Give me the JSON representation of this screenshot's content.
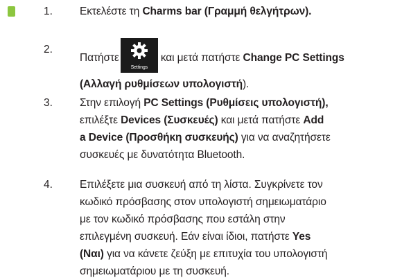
{
  "steps": [
    {
      "number": "1.",
      "lines": [
        [
          {
            "t": "Εκτελέστε τη ",
            "b": false
          },
          {
            "t": "Charms bar (Γραμμή θελγήτρων).",
            "b": true
          }
        ]
      ]
    },
    {
      "number": "2.",
      "lines": [
        [
          {
            "t": "Πατήστε",
            "b": false
          },
          {
            "tile": true
          },
          {
            "t": "και μετά πατήστε ",
            "b": false
          },
          {
            "t": "Change PC Settings",
            "b": true
          }
        ],
        [
          {
            "t": "(Αλλαγή ρυθμίσεων υπολογιστή",
            "b": true
          },
          {
            "t": ").",
            "b": false
          }
        ]
      ]
    },
    {
      "number": "3.",
      "lines": [
        [
          {
            "t": "Στην επιλογή ",
            "b": false
          },
          {
            "t": "PC Settings (Ρυθμίσεις υπολογιστή),",
            "b": true
          }
        ],
        [
          {
            "t": "επιλέξτε ",
            "b": false
          },
          {
            "t": "Devices (Συσκευές)",
            "b": true
          },
          {
            "t": " και μετά πατήστε ",
            "b": false
          },
          {
            "t": "Add",
            "b": true
          }
        ],
        [
          {
            "t": "a Device (Προσθήκη συσκευής)",
            "b": true
          },
          {
            "t": " για να αναζητήσετε",
            "b": false
          }
        ],
        [
          {
            "t": "συσκευές με δυνατότητα Bluetooth.",
            "b": false
          }
        ]
      ]
    },
    {
      "number": "4.",
      "lines": [
        [
          {
            "t": "Επιλέξετε μια συσκευή από τη λίστα. Συγκρίνετε τον",
            "b": false
          }
        ],
        [
          {
            "t": "κωδικό πρόσβασης στον υπολογιστή σημειωματάριο",
            "b": false
          }
        ],
        [
          {
            "t": "με τον κωδικό πρόσβασης που εστάλη στην",
            "b": false
          }
        ],
        [
          {
            "t": "επιλεγμένη συσκευή. Εάν είναι ίδιοι, πατήστε ",
            "b": false
          },
          {
            "t": "Yes",
            "b": true
          }
        ],
        [
          {
            "t": "(Ναι)",
            "b": true
          },
          {
            "t": " για να κάνετε ζεύξη με επιτυχία του υπολογιστή",
            "b": false
          }
        ],
        [
          {
            "t": "σημειωματάριου με τη συσκευή.",
            "b": false
          }
        ]
      ]
    }
  ],
  "settings_tile": {
    "label": "Settings",
    "icon": "gear-icon",
    "background": "#1b1b1b"
  },
  "colors": {
    "marker": "#8cc63f",
    "text": "#231f20"
  }
}
